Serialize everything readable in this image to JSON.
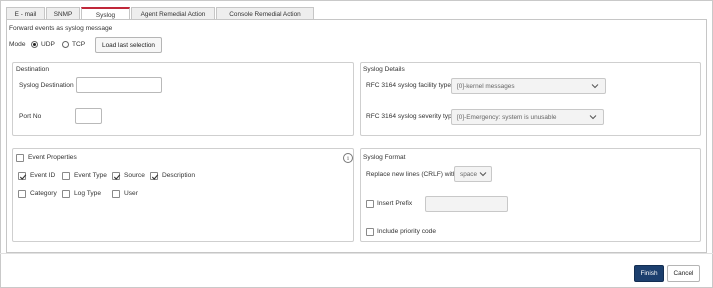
{
  "tabs": [
    {
      "label": "E - mail",
      "active": false
    },
    {
      "label": "SNMP",
      "active": false
    },
    {
      "label": "Syslog",
      "active": true
    },
    {
      "label": "Agent Remedial Action",
      "active": false
    },
    {
      "label": "Console Remedial Action",
      "active": false
    }
  ],
  "forward": {
    "heading": "Forward events as syslog message",
    "mode_label": "Mode",
    "udp_label": "UDP",
    "tcp_label": "TCP",
    "selected_mode": "UDP",
    "load_button": "Load last selection"
  },
  "destination": {
    "title": "Destination",
    "syslog_destination_label": "Syslog Destination",
    "syslog_destination_value": "",
    "port_label": "Port No",
    "port_value": ""
  },
  "syslog_details": {
    "title": "Syslog Details",
    "facility_label": "RFC 3164 syslog facility type",
    "facility_value": "[0]-kernel messages",
    "severity_label": "RFC 3164 syslog severity type",
    "severity_value": "[0]-Emergency: system is unusable"
  },
  "event_properties": {
    "title": "Event Properties",
    "checked": false,
    "items": [
      {
        "label": "Event ID",
        "checked": true
      },
      {
        "label": "Event Type",
        "checked": false
      },
      {
        "label": "Source",
        "checked": true
      },
      {
        "label": "Description",
        "checked": true
      },
      {
        "label": "Category",
        "checked": false
      },
      {
        "label": "Log Type",
        "checked": false
      },
      {
        "label": "User",
        "checked": false
      }
    ]
  },
  "syslog_format": {
    "title": "Syslog Format",
    "replace_label": "Replace new lines (CRLF) with",
    "replace_value": "space",
    "insert_prefix_label": "Insert Prefix",
    "insert_prefix_checked": false,
    "prefix_value": "",
    "include_priority_label": "Include priority code",
    "include_priority_checked": false
  },
  "footer": {
    "finish": "Finish",
    "cancel": "Cancel"
  },
  "colors": {
    "active_tab_accent": "#c0283a",
    "primary_button": "#1c3f6e"
  }
}
